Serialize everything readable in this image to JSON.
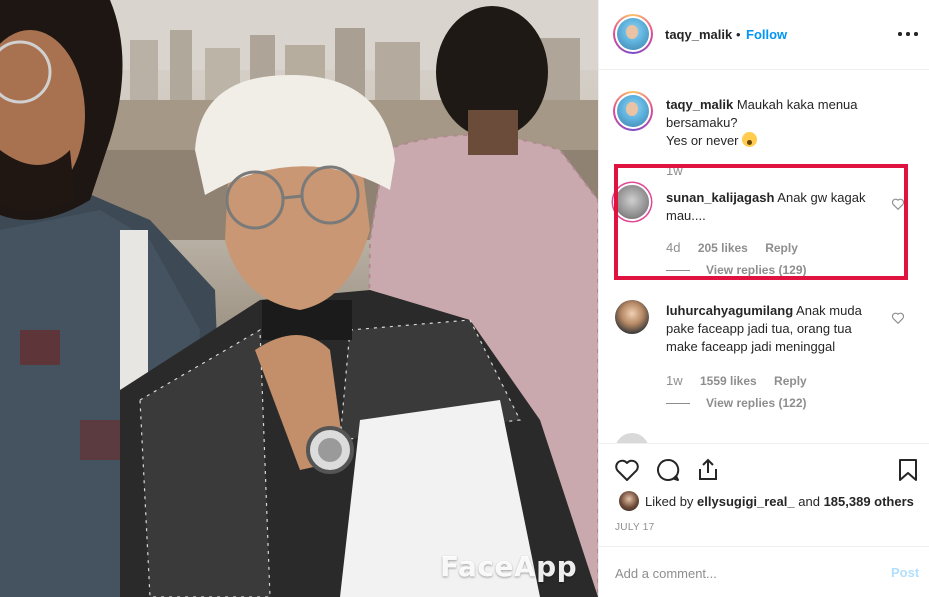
{
  "photo": {
    "watermark": "FaceApp"
  },
  "header": {
    "username": "taqy_malik",
    "separator": "•",
    "follow_label": "Follow"
  },
  "caption": {
    "username": "taqy_malik",
    "text_line1": "Maukah kaka menua",
    "text_line2": "bersamaku?",
    "text_line3": "Yes or never",
    "time": "1w"
  },
  "comments": [
    {
      "username": "sunan_kalijagash",
      "text": "Anak gw kagak mau....",
      "time": "4d",
      "likes": "205 likes",
      "reply": "Reply",
      "view_replies": "View replies (129)"
    },
    {
      "username": "luhurcahyagumilang",
      "text": "Anak muda pake faceapp jadi tua, orang tua make faceapp jadi meninggal",
      "time": "1w",
      "likes": "1559 likes",
      "reply": "Reply",
      "view_replies": "View replies (122)"
    },
    {
      "username": "",
      "text": ""
    }
  ],
  "likes_line": {
    "prefix": "Liked by",
    "user": "ellysugigi_real_",
    "middle": "and",
    "count": "185,389 others"
  },
  "date": "JULY 17",
  "add_comment": {
    "placeholder": "Add a comment...",
    "post_label": "Post"
  },
  "colors": {
    "accent": "#0095f6",
    "highlight": "#e0123f",
    "post_disabled": "#b2dffc",
    "muted": "#8e8e8e"
  },
  "icons": [
    "more-options-icon",
    "heart-icon",
    "comment-icon",
    "share-icon",
    "bookmark-icon",
    "small-heart-icon"
  ]
}
